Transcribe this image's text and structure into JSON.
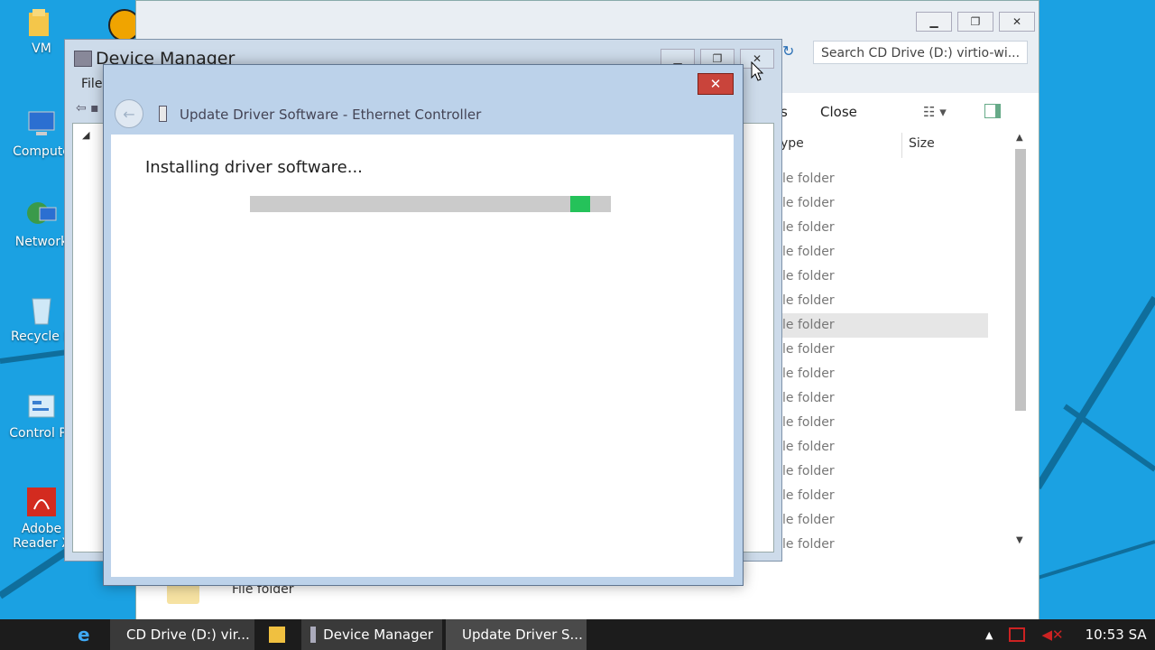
{
  "desktop": {
    "icons": [
      {
        "label": "VM"
      },
      {
        "label": "Compute"
      },
      {
        "label": "Network"
      },
      {
        "label": "Recycle B"
      },
      {
        "label": "Control Pa"
      },
      {
        "label": "Adobe",
        "label2": "Reader X"
      }
    ]
  },
  "explorer": {
    "search_placeholder": "Search CD Drive (D:) virtio-wi...",
    "toolbar_partial": "s",
    "toolbar_close": "Close",
    "col_type": "ype",
    "col_size": "Size",
    "rows": [
      "le folder",
      "le folder",
      "le folder",
      "le folder",
      "le folder",
      "le folder",
      "le folder",
      "le folder",
      "le folder",
      "le folder",
      "le folder",
      "le folder",
      "le folder",
      "le folder",
      "le folder",
      "le folder"
    ],
    "selected_row_index": 6,
    "bottom_row_text": "File folder"
  },
  "device_manager": {
    "title": "Device Manager",
    "menu_file": "File"
  },
  "dialog": {
    "title": "Update Driver Software - Ethernet Controller",
    "heading": "Installing driver software...",
    "progress_fraction": 0.94
  },
  "taskbar": {
    "items": [
      {
        "label": "CD Drive (D:) vir..."
      },
      {
        "label": "Device Manager"
      },
      {
        "label": "Update Driver S..."
      }
    ],
    "clock": "10:53 SA"
  },
  "colors": {
    "desktop": "#1ba1e2",
    "progress_fill": "#25c25a",
    "close_button": "#c9443b"
  }
}
